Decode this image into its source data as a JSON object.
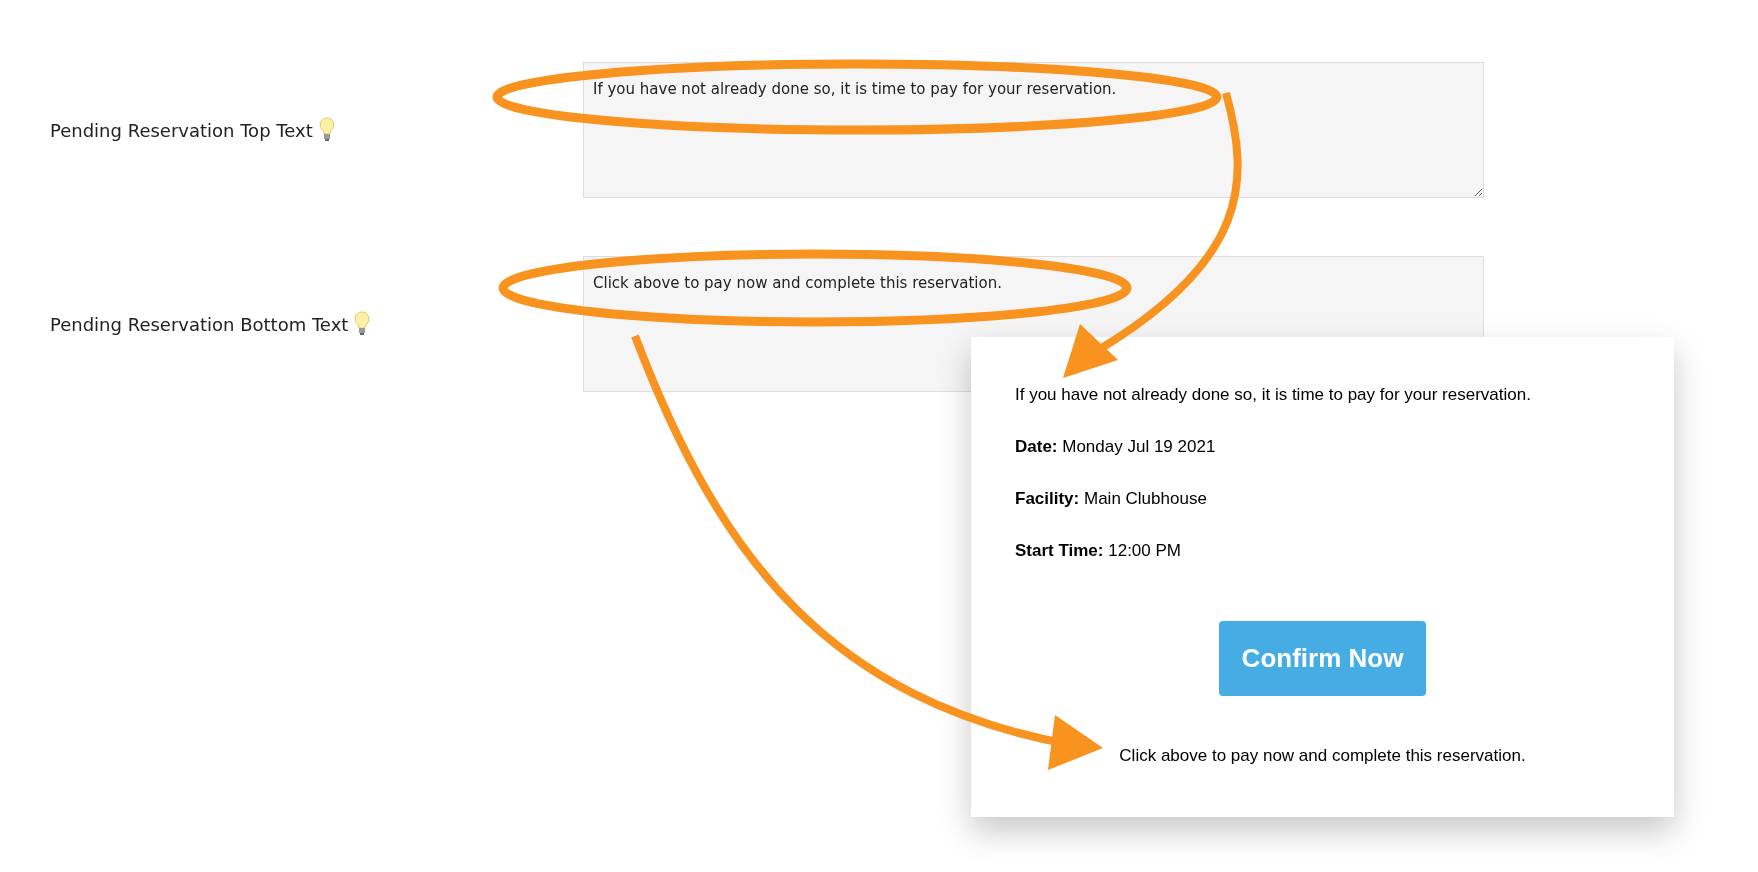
{
  "settings": [
    {
      "label": "Pending Reservation Top Text",
      "value": "If you have not already done so, it is time to pay for your reservation."
    },
    {
      "label": "Pending Reservation Bottom Text",
      "value": "Click above to pay now and complete this reservation."
    }
  ],
  "preview": {
    "top_text": "If you have not already done so, it is time to pay for your reservation.",
    "details": [
      {
        "label": "Date:",
        "value": "Monday Jul 19 2021"
      },
      {
        "label": "Facility:",
        "value": "Main Clubhouse"
      },
      {
        "label": "Start Time:",
        "value": "12:00 PM"
      }
    ],
    "button": "Confirm Now",
    "bottom_text": "Click above to pay now and complete this reservation."
  }
}
